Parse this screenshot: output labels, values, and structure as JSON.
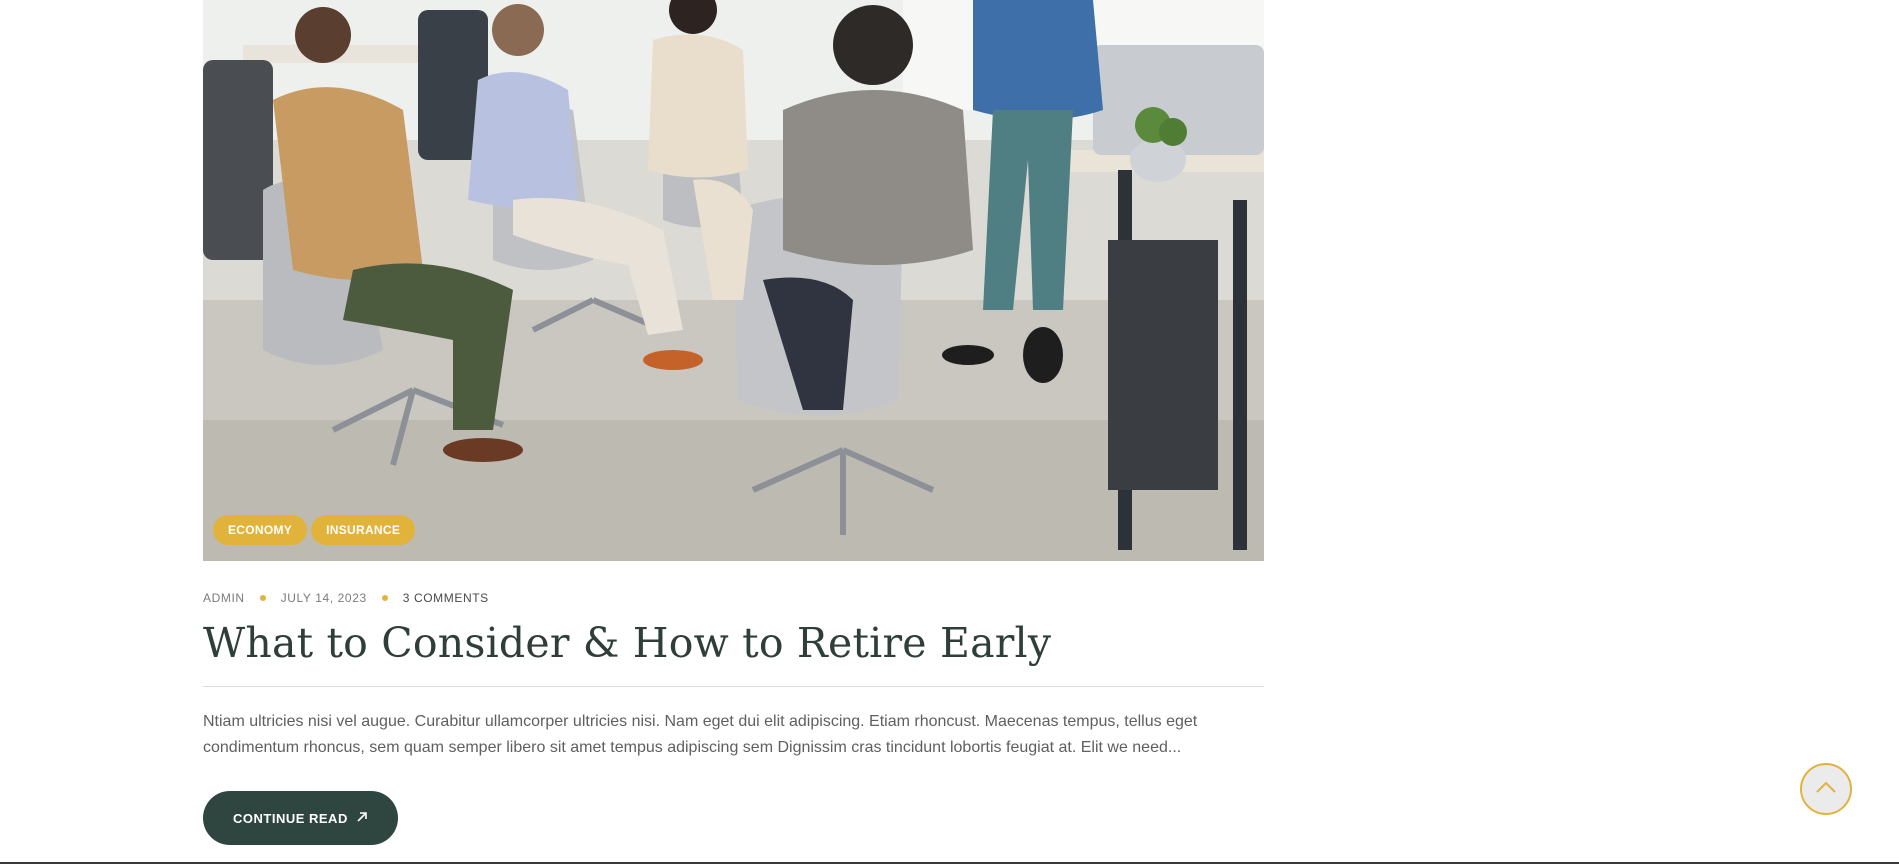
{
  "post": {
    "image_alt": "people sitting in a circle in office",
    "categories": [
      "ECONOMY",
      "INSURANCE"
    ],
    "meta": {
      "author": "ADMIN",
      "date": "JULY 14, 2023",
      "comments": "3 COMMENTS"
    },
    "title": "What to Consider & How to Retire Early",
    "excerpt": "Ntiam ultricies nisi vel augue. Curabitur ullamcorper ultricies nisi. Nam eget dui elit adipiscing. Etiam rhoncust. Maecenas tempus, tellus eget condimentum rhoncus, sem quam semper libero sit amet tempus adipiscing sem Dignissim cras tincidunt lobortis feugiat at. Elit we need...",
    "button_label": "CONTINUE READ",
    "button_icon": "arrow-up-right-icon"
  },
  "scroll_top": {
    "icon": "chevron-up-icon"
  },
  "colors": {
    "accent": "#e2b33a",
    "dark": "#2f4540",
    "title": "#2f3e39"
  }
}
